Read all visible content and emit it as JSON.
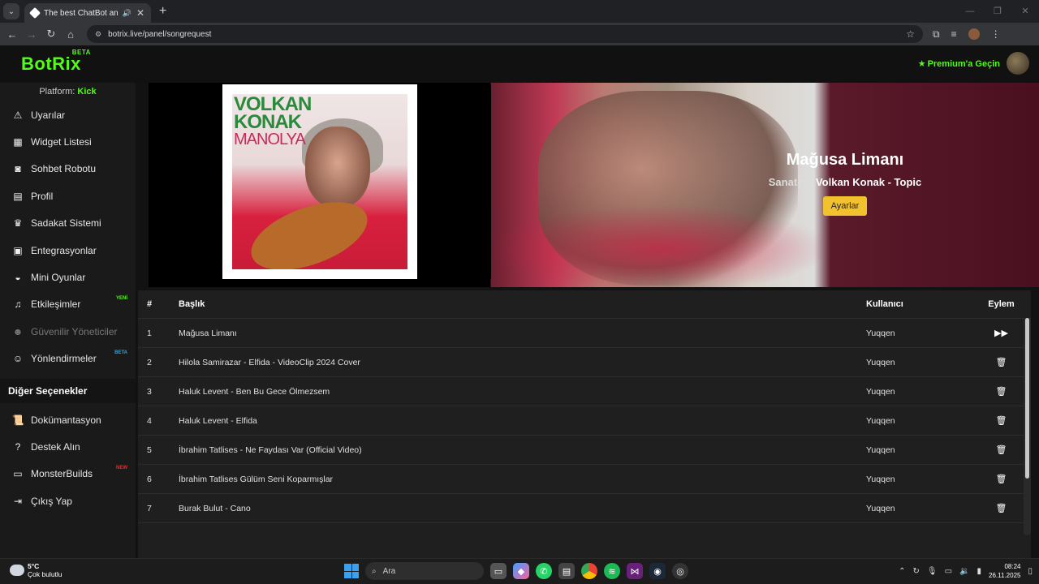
{
  "browser": {
    "tab_title": "The best ChatBot and Wid",
    "url": "botrix.live/panel/songrequest"
  },
  "header": {
    "logo": "BotRix",
    "logo_badge": "BETA",
    "premium": "Premium'a Geçin"
  },
  "sidebar": {
    "platform_label": "Platform:",
    "platform_value": "Kick",
    "items": [
      {
        "label": "Uyarılar",
        "icon": "warning-icon"
      },
      {
        "label": "Widget Listesi",
        "icon": "grid-icon"
      },
      {
        "label": "Sohbet Robotu",
        "icon": "robot-icon"
      },
      {
        "label": "Profil",
        "icon": "id-card-icon"
      },
      {
        "label": "Sadakat Sistemi",
        "icon": "trophy-icon"
      },
      {
        "label": "Entegrasyonlar",
        "icon": "plug-icon"
      },
      {
        "label": "Mini Oyunlar",
        "icon": "gamepad-icon"
      },
      {
        "label": "Etkileşimler",
        "icon": "music-icon",
        "badge": "YENİ"
      },
      {
        "label": "Güvenilir Yöneticiler",
        "icon": "users-icon"
      },
      {
        "label": "Yönlendirmeler",
        "icon": "user-group-icon",
        "badge": "BETA"
      }
    ],
    "section_title": "Diğer Seçenekler",
    "other_items": [
      {
        "label": "Dokümantasyon",
        "icon": "scroll-icon"
      },
      {
        "label": "Destek Alın",
        "icon": "question-icon"
      },
      {
        "label": "MonsterBuilds",
        "icon": "laptop-icon",
        "badge": "NEW"
      },
      {
        "label": "Çıkış Yap",
        "icon": "logout-icon"
      }
    ]
  },
  "now_playing": {
    "cover_line1": "VOLKAN",
    "cover_line2": "KONAK",
    "cover_line3": "MANOLYA",
    "title": "Mağusa Limanı",
    "artist_label": "Sanatçı:",
    "artist": "Volkan Konak - Topic",
    "settings_button": "Ayarlar"
  },
  "table": {
    "headers": {
      "num": "#",
      "title": "Başlık",
      "user": "Kullanıcı",
      "action": "Eylem"
    },
    "rows": [
      {
        "num": "1",
        "title": "Mağusa Limanı",
        "user": "Yuqqen",
        "action": "skip-icon"
      },
      {
        "num": "2",
        "title": "Hilola Samirazar - Elfida - VideoClip 2024 Cover",
        "user": "Yuqqen",
        "action": "trash-icon"
      },
      {
        "num": "3",
        "title": "Haluk Levent - Ben Bu Gece Ölmezsem",
        "user": "Yuqqen",
        "action": "trash-icon"
      },
      {
        "num": "4",
        "title": "Haluk Levent - Elfida",
        "user": "Yuqqen",
        "action": "trash-icon"
      },
      {
        "num": "5",
        "title": "İbrahim Tatlises - Ne Faydası Var (Official Video)",
        "user": "Yuqqen",
        "action": "trash-icon"
      },
      {
        "num": "6",
        "title": "İbrahim Tatlises Gülüm Seni Koparmışlar",
        "user": "Yuqqen",
        "action": "trash-icon"
      },
      {
        "num": "7",
        "title": "Burak Bulut - Cano",
        "user": "Yuqqen",
        "action": "trash-icon"
      }
    ]
  },
  "taskbar": {
    "temp": "5°C",
    "weather": "Çok bulutlu",
    "search": "Ara",
    "time": "08:24",
    "date": "26.11.2025"
  },
  "colors": {
    "brand": "#53fc18",
    "button": "#f2c12e",
    "background": "#121212"
  }
}
